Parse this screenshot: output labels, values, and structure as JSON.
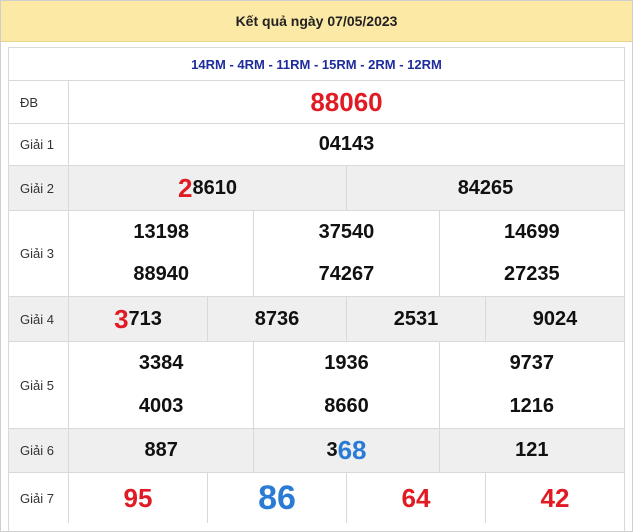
{
  "title": "Kết quả ngày 07/05/2023",
  "provinces": "14RM - 4RM - 11RM - 15RM - 2RM - 12RM",
  "prizes": {
    "db": {
      "label": "ĐB",
      "value": "88060"
    },
    "g1": {
      "label": "Giải 1",
      "value": "04143"
    },
    "g2": {
      "label": "Giải 2",
      "values": [
        {
          "lead": "2",
          "rest": "8610"
        },
        {
          "lead": "",
          "rest": "84265"
        }
      ]
    },
    "g3": {
      "label": "Giải 3",
      "values": [
        "13198",
        "37540",
        "14699",
        "88940",
        "74267",
        "27235"
      ]
    },
    "g4": {
      "label": "Giải 4",
      "values": [
        {
          "lead": "3",
          "rest": "713"
        },
        {
          "lead": "",
          "rest": "8736"
        },
        {
          "lead": "",
          "rest": "2531"
        },
        {
          "lead": "",
          "rest": "9024"
        }
      ]
    },
    "g5": {
      "label": "Giải 5",
      "values": [
        "3384",
        "1936",
        "9737",
        "4003",
        "8660",
        "1216"
      ]
    },
    "g6": {
      "label": "Giải 6",
      "values": [
        {
          "lead": "887",
          "tail": ""
        },
        {
          "lead": "3",
          "tail": "68"
        },
        {
          "lead": "121",
          "tail": ""
        }
      ]
    },
    "g7": {
      "label": "Giải 7",
      "values": [
        "95",
        "86",
        "64",
        "42"
      ]
    }
  },
  "colors": {
    "special": "#e01b24",
    "highlight_red": "#e01b24",
    "highlight_blue": "#2a7bd6",
    "header_bg": "#fde9a6",
    "province_text": "#1f2d9c"
  }
}
